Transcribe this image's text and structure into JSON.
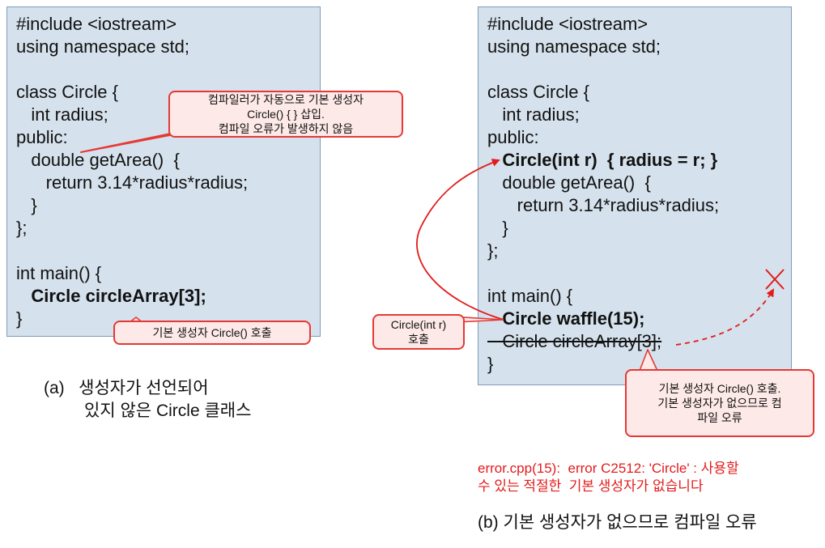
{
  "panel_a": {
    "code": [
      "#include <iostream>",
      "using namespace std;",
      "",
      "class Circle {",
      "   int radius;",
      "public:",
      "   double getArea()  {",
      "      return 3.14*radius*radius;",
      "   }",
      "};",
      "",
      "int main() {",
      "   Circle circleArray[3];",
      "}"
    ],
    "callout_auto_ctor": [
      "컴파일러가 자동으로 기본 생성자",
      "Circle() { } 삽입.",
      "컴파일 오류가 발생하지 않음"
    ],
    "callout_call": "기본 생성자 Circle() 호출",
    "caption": [
      "(a)   생성자가 선언되어",
      "있지 않은 Circle 클래스"
    ]
  },
  "panel_b": {
    "code": [
      "#include <iostream>",
      "using namespace std;",
      "",
      "class Circle {",
      "   int radius;",
      "public:",
      "   Circle(int r)  { radius = r; }",
      "   double getArea()  {",
      "      return 3.14*radius*radius;",
      "   }",
      "};",
      "",
      "int main() {",
      "   Circle waffle(15);",
      "   Circle circleArray[3];",
      "}"
    ],
    "callout_ctor_call": [
      "Circle(int r)",
      "호출"
    ],
    "callout_error": [
      "기본 생성자 Circle() 호출.",
      "기본 생성자가 없으므로 컴",
      "파일 오류"
    ],
    "error_message": [
      "error.cpp(15):  error C2512: 'Circle' : 사용할",
      "수 있는 적절한  기본 생성자가 없습니다"
    ],
    "caption": "(b) 기본 생성자가 없으므로 컴파일 오류"
  },
  "colors": {
    "code_bg": "#d5e1ec",
    "code_border": "#7f9db9",
    "accent_red": "#e31b1b",
    "callout_bg": "#fde9e7"
  }
}
